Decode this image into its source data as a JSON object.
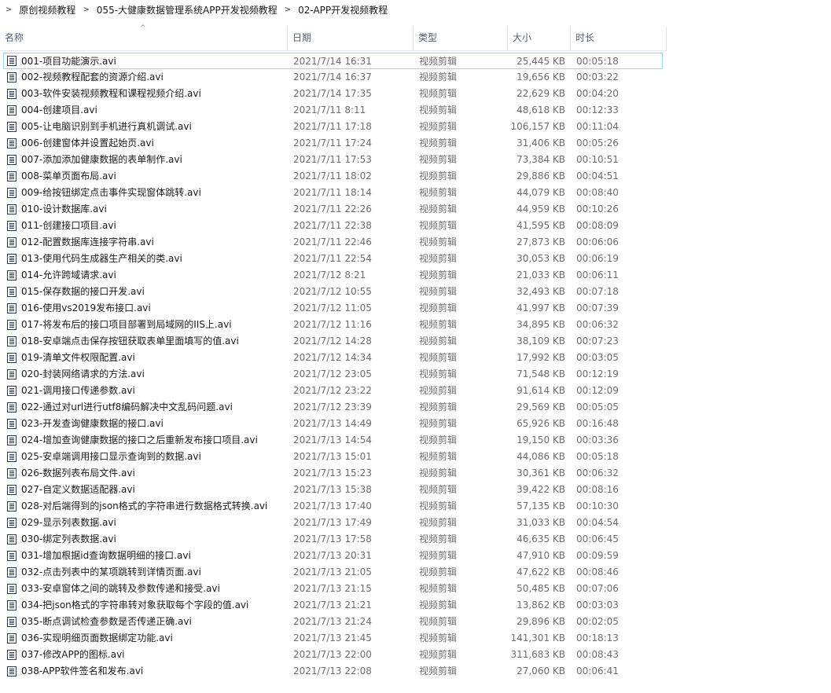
{
  "breadcrumb": {
    "items": [
      "原创视频教程",
      "055-大健康数据管理系统APP开发视频教程",
      "02-APP开发视频教程"
    ],
    "separator": ">"
  },
  "columns": {
    "name": "名称",
    "date": "日期",
    "type": "类型",
    "size": "大小",
    "duration": "时长",
    "sort_indicator": "^"
  },
  "files": [
    {
      "name": "001-项目功能演示.avi",
      "date": "2021/7/14 16:31",
      "type": "视频剪辑",
      "size": "25,445 KB",
      "duration": "00:05:18",
      "selected": true
    },
    {
      "name": "002-视频教程配套的资源介绍.avi",
      "date": "2021/7/14 16:37",
      "type": "视频剪辑",
      "size": "19,656 KB",
      "duration": "00:03:22"
    },
    {
      "name": "003-软件安装视频教程和课程视频介绍.avi",
      "date": "2021/7/14 17:35",
      "type": "视频剪辑",
      "size": "22,629 KB",
      "duration": "00:04:20"
    },
    {
      "name": "004-创建项目.avi",
      "date": "2021/7/11 8:11",
      "type": "视频剪辑",
      "size": "48,618 KB",
      "duration": "00:12:33"
    },
    {
      "name": "005-让电脑识别到手机进行真机调试.avi",
      "date": "2021/7/11 17:18",
      "type": "视频剪辑",
      "size": "106,157 KB",
      "duration": "00:11:04"
    },
    {
      "name": "006-创建窗体并设置起始页.avi",
      "date": "2021/7/11 17:24",
      "type": "视频剪辑",
      "size": "31,406 KB",
      "duration": "00:05:26"
    },
    {
      "name": "007-添加添加健康数据的表单制作.avi",
      "date": "2021/7/11 17:53",
      "type": "视频剪辑",
      "size": "73,384 KB",
      "duration": "00:10:51"
    },
    {
      "name": "008-菜单页面布局.avi",
      "date": "2021/7/11 18:02",
      "type": "视频剪辑",
      "size": "29,886 KB",
      "duration": "00:04:51"
    },
    {
      "name": "009-给按钮绑定点击事件实现窗体跳转.avi",
      "date": "2021/7/11 18:14",
      "type": "视频剪辑",
      "size": "44,079 KB",
      "duration": "00:08:40"
    },
    {
      "name": "010-设计数据库.avi",
      "date": "2021/7/11 22:26",
      "type": "视频剪辑",
      "size": "44,959 KB",
      "duration": "00:10:26"
    },
    {
      "name": "011-创建接口项目.avi",
      "date": "2021/7/11 22:38",
      "type": "视频剪辑",
      "size": "41,595 KB",
      "duration": "00:08:09"
    },
    {
      "name": "012-配置数据库连接字符串.avi",
      "date": "2021/7/11 22:46",
      "type": "视频剪辑",
      "size": "27,873 KB",
      "duration": "00:06:06"
    },
    {
      "name": "013-使用代码生成器生产相关的类.avi",
      "date": "2021/7/11 22:54",
      "type": "视频剪辑",
      "size": "30,053 KB",
      "duration": "00:06:19"
    },
    {
      "name": "014-允许跨域请求.avi",
      "date": "2021/7/12 8:21",
      "type": "视频剪辑",
      "size": "21,033 KB",
      "duration": "00:06:11"
    },
    {
      "name": "015-保存数据的接口开发.avi",
      "date": "2021/7/12 10:55",
      "type": "视频剪辑",
      "size": "32,493 KB",
      "duration": "00:07:18"
    },
    {
      "name": "016-使用vs2019发布接口.avi",
      "date": "2021/7/12 11:05",
      "type": "视频剪辑",
      "size": "41,997 KB",
      "duration": "00:07:39"
    },
    {
      "name": "017-将发布后的接口项目部署到局域网的IIS上.avi",
      "date": "2021/7/12 11:16",
      "type": "视频剪辑",
      "size": "34,895 KB",
      "duration": "00:06:32"
    },
    {
      "name": "018-安卓端点击保存按钮获取表单里面填写的值.avi",
      "date": "2021/7/12 14:28",
      "type": "视频剪辑",
      "size": "38,109 KB",
      "duration": "00:07:23"
    },
    {
      "name": "019-清单文件权限配置.avi",
      "date": "2021/7/12 14:34",
      "type": "视频剪辑",
      "size": "17,992 KB",
      "duration": "00:03:05"
    },
    {
      "name": "020-封装网络请求的方法.avi",
      "date": "2021/7/12 23:05",
      "type": "视频剪辑",
      "size": "71,548 KB",
      "duration": "00:12:19"
    },
    {
      "name": "021-调用接口传递参数.avi",
      "date": "2021/7/12 23:22",
      "type": "视频剪辑",
      "size": "91,614 KB",
      "duration": "00:12:09"
    },
    {
      "name": "022-通过对url进行utf8编码解决中文乱码问题.avi",
      "date": "2021/7/12 23:39",
      "type": "视频剪辑",
      "size": "29,569 KB",
      "duration": "00:05:05"
    },
    {
      "name": "023-开发查询健康数据的接口.avi",
      "date": "2021/7/13 14:49",
      "type": "视频剪辑",
      "size": "65,926 KB",
      "duration": "00:16:48"
    },
    {
      "name": "024-增加查询健康数据的接口之后重新发布接口项目.avi",
      "date": "2021/7/13 14:54",
      "type": "视频剪辑",
      "size": "19,150 KB",
      "duration": "00:03:36"
    },
    {
      "name": "025-安卓端调用接口显示查询到的数据.avi",
      "date": "2021/7/13 15:01",
      "type": "视频剪辑",
      "size": "44,086 KB",
      "duration": "00:05:18"
    },
    {
      "name": "026-数据列表布局文件.avi",
      "date": "2021/7/13 15:23",
      "type": "视频剪辑",
      "size": "30,361 KB",
      "duration": "00:06:32"
    },
    {
      "name": "027-自定义数据适配器.avi",
      "date": "2021/7/13 15:38",
      "type": "视频剪辑",
      "size": "39,422 KB",
      "duration": "00:08:16"
    },
    {
      "name": "028-对后端得到的json格式的字符串进行数据格式转换.avi",
      "date": "2021/7/13 17:40",
      "type": "视频剪辑",
      "size": "57,135 KB",
      "duration": "00:10:30"
    },
    {
      "name": "029-显示列表数据.avi",
      "date": "2021/7/13 17:49",
      "type": "视频剪辑",
      "size": "31,033 KB",
      "duration": "00:04:54"
    },
    {
      "name": "030-绑定列表数据.avi",
      "date": "2021/7/13 17:58",
      "type": "视频剪辑",
      "size": "46,635 KB",
      "duration": "00:06:45"
    },
    {
      "name": "031-增加根据id查询数据明细的接口.avi",
      "date": "2021/7/13 20:31",
      "type": "视频剪辑",
      "size": "47,910 KB",
      "duration": "00:09:59"
    },
    {
      "name": "032-点击列表中的某项跳转到详情页面.avi",
      "date": "2021/7/13 21:05",
      "type": "视频剪辑",
      "size": "47,622 KB",
      "duration": "00:08:46"
    },
    {
      "name": "033-安卓窗体之间的跳转及参数传递和接受.avi",
      "date": "2021/7/13 21:15",
      "type": "视频剪辑",
      "size": "50,485 KB",
      "duration": "00:07:06"
    },
    {
      "name": "034-把json格式的字符串转对象获取每个字段的值.avi",
      "date": "2021/7/13 21:21",
      "type": "视频剪辑",
      "size": "13,862 KB",
      "duration": "00:03:03"
    },
    {
      "name": "035-断点调试检查参数是否传递正确.avi",
      "date": "2021/7/13 21:24",
      "type": "视频剪辑",
      "size": "29,896 KB",
      "duration": "00:02:05"
    },
    {
      "name": "036-实现明细页面数据绑定功能.avi",
      "date": "2021/7/13 21:45",
      "type": "视频剪辑",
      "size": "141,301 KB",
      "duration": "00:18:13"
    },
    {
      "name": "037-修改APP的图标.avi",
      "date": "2021/7/13 22:00",
      "type": "视频剪辑",
      "size": "311,683 KB",
      "duration": "00:08:43"
    },
    {
      "name": "038-APP软件签名和发布.avi",
      "date": "2021/7/13 22:08",
      "type": "视频剪辑",
      "size": "27,060 KB",
      "duration": "00:06:41"
    }
  ]
}
